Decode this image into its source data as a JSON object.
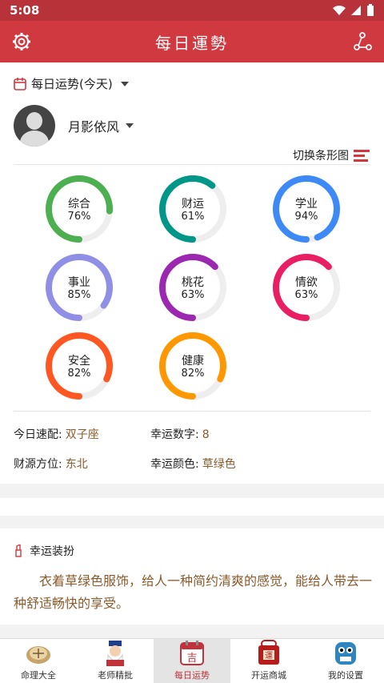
{
  "status": {
    "time": "5:08"
  },
  "app": {
    "title": "每日運勢"
  },
  "section": {
    "title": "每日运势(今天)"
  },
  "profile": {
    "name": "月影依风"
  },
  "toggle": {
    "label": "切换条形图"
  },
  "rings": [
    {
      "name": "综合",
      "value": 76,
      "pct": "76%",
      "color": "#4caf50"
    },
    {
      "name": "财运",
      "value": 61,
      "pct": "61%",
      "color": "#009688"
    },
    {
      "name": "学业",
      "value": 94,
      "pct": "94%",
      "color": "#3d8af7"
    },
    {
      "name": "事业",
      "value": 85,
      "pct": "85%",
      "color": "#8f8fe6"
    },
    {
      "name": "桃花",
      "value": 63,
      "pct": "63%",
      "color": "#9c27b0"
    },
    {
      "name": "情欲",
      "value": 63,
      "pct": "63%",
      "color": "#e91e63"
    },
    {
      "name": "安全",
      "value": 82,
      "pct": "82%",
      "color": "#ff5722"
    },
    {
      "name": "健康",
      "value": 82,
      "pct": "82%",
      "color": "#ff9800"
    }
  ],
  "info": {
    "match_label": "今日速配:",
    "match_value": "双子座",
    "number_label": "幸运数字:",
    "number_value": "8",
    "direction_label": "财源方位:",
    "direction_value": "东北",
    "color_label": "幸运颜色:",
    "color_value": "草绿色"
  },
  "lucky": {
    "title": "幸运装扮",
    "text": "衣着草绿色服饰，给人一种简约清爽的感觉，能给人带去一种舒适畅快的享受。"
  },
  "tabs": [
    {
      "label": "命理大全",
      "icon": "compass-icon"
    },
    {
      "label": "老师精批",
      "icon": "master-icon"
    },
    {
      "label": "每日运势",
      "icon": "calendar-icon",
      "active": true
    },
    {
      "label": "开运商城",
      "icon": "shop-icon"
    },
    {
      "label": "我的设置",
      "icon": "profile-icon"
    }
  ],
  "colors": {
    "appbar": "#d0393f",
    "accent_text": "#8a5a2b",
    "active_tab": "#c0333b"
  }
}
